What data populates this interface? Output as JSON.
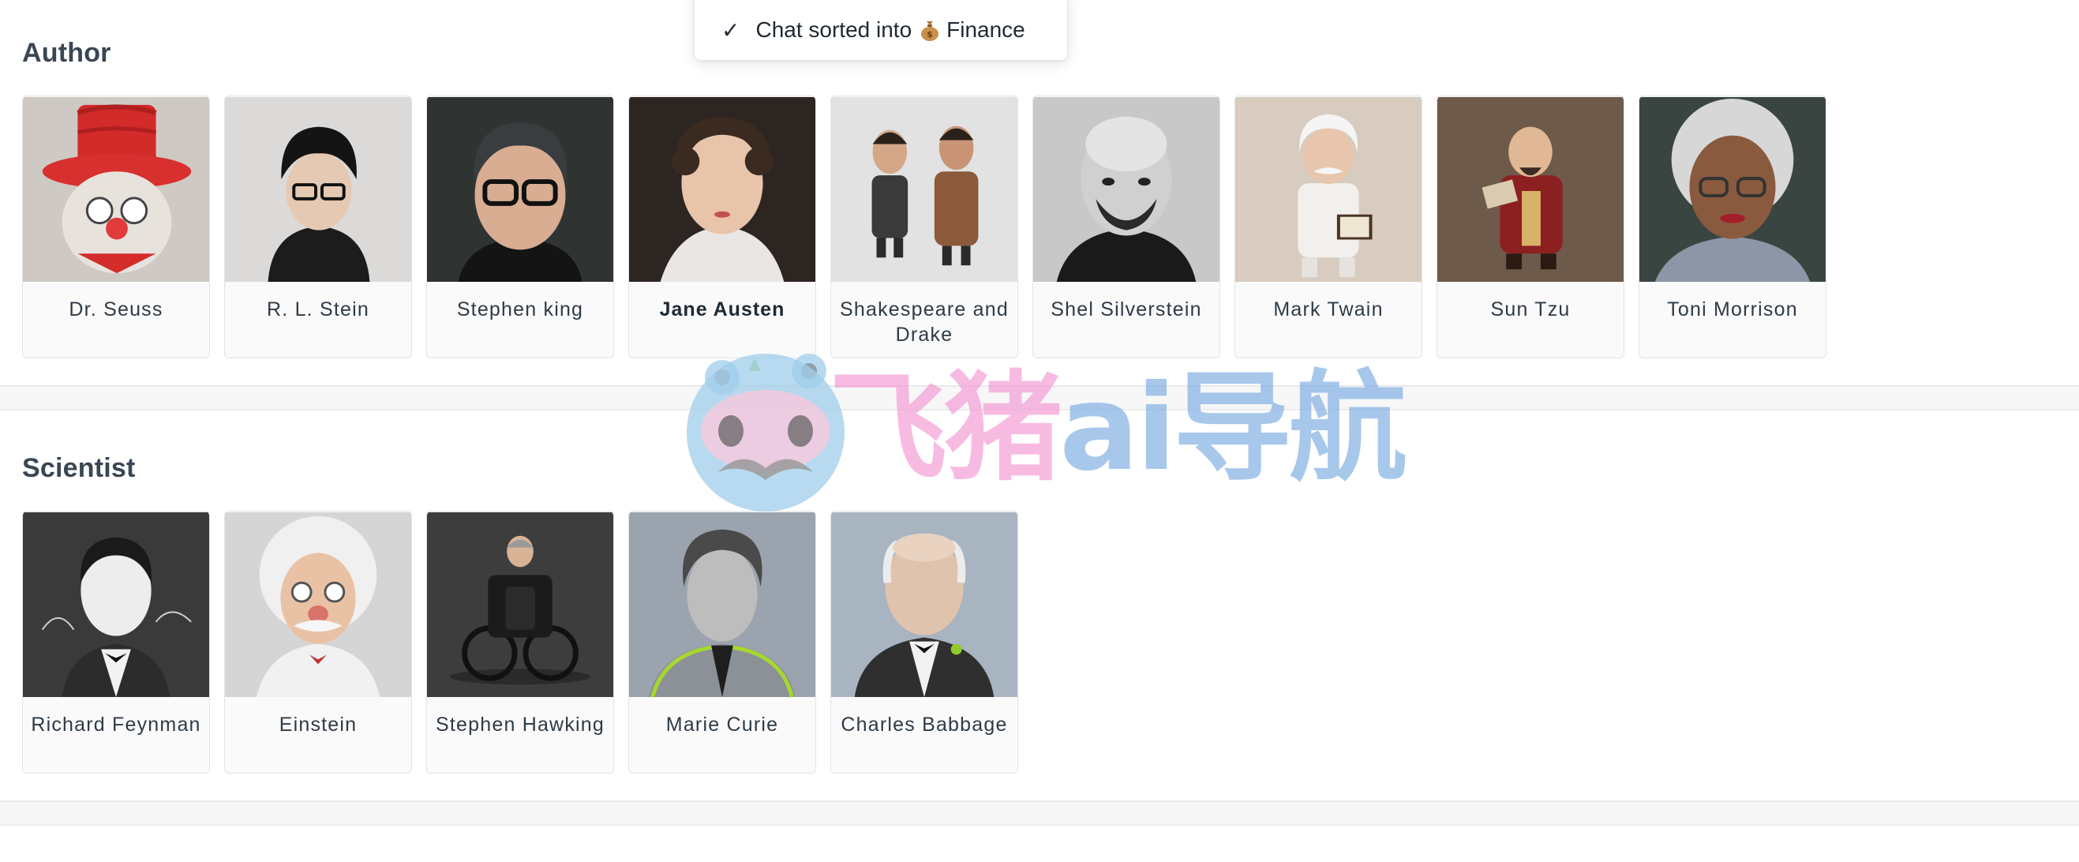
{
  "toast": {
    "check_icon": "checkmark-icon",
    "text_before": "Chat sorted into",
    "folder_icon": "money-bag-icon",
    "folder_name": "Finance"
  },
  "sections": [
    {
      "title": "Author",
      "cards": [
        {
          "name": "Dr. Seuss"
        },
        {
          "name": "R. L. Stein"
        },
        {
          "name": "Stephen king"
        },
        {
          "name": "Jane Austen"
        },
        {
          "name": "Shakespeare and Drake"
        },
        {
          "name": "Shel Silverstein"
        },
        {
          "name": "Mark Twain"
        },
        {
          "name": "Sun Tzu"
        },
        {
          "name": "Toni Morrison"
        }
      ]
    },
    {
      "title": "Scientist",
      "cards": [
        {
          "name": "Richard Feynman"
        },
        {
          "name": "Einstein"
        },
        {
          "name": "Stephen Hawking"
        },
        {
          "name": "Marie Curie"
        },
        {
          "name": "Charles Babbage"
        }
      ]
    }
  ],
  "watermark": {
    "text_pink": "飞猪",
    "text_blue": "ai导航"
  }
}
